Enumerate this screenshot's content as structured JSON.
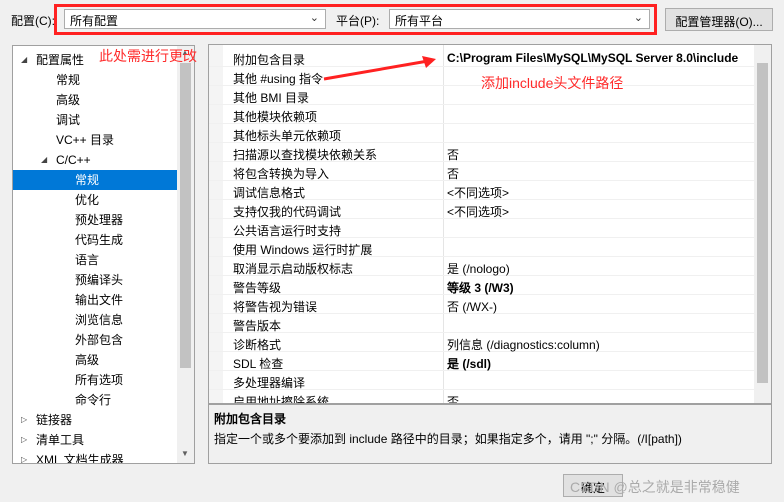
{
  "top": {
    "config_label": "配置(C):",
    "config_value": "所有配置",
    "platform_label": "平台(P):",
    "platform_value": "所有平台",
    "config_manager_button": "配置管理器(O)..."
  },
  "annotations": {
    "change_here": "此处需进行更改",
    "include_note": "添加include头文件路径",
    "accent": "#ff2121"
  },
  "tree": {
    "items": [
      {
        "label": "配置属性",
        "twisty": "◢"
      },
      {
        "label": "常规"
      },
      {
        "label": "高级"
      },
      {
        "label": "调试"
      },
      {
        "label": "VC++ 目录"
      },
      {
        "label": "C/C++",
        "twisty": "◢"
      },
      {
        "label": "常规"
      },
      {
        "label": "优化"
      },
      {
        "label": "预处理器"
      },
      {
        "label": "代码生成"
      },
      {
        "label": "语言"
      },
      {
        "label": "预编译头"
      },
      {
        "label": "输出文件"
      },
      {
        "label": "浏览信息"
      },
      {
        "label": "外部包含"
      },
      {
        "label": "高级"
      },
      {
        "label": "所有选项"
      },
      {
        "label": "命令行"
      },
      {
        "label": "链接器",
        "twisty": "▷"
      },
      {
        "label": "清单工具",
        "twisty": "▷"
      },
      {
        "label": "XML 文档生成器",
        "twisty": "▷"
      }
    ],
    "selected_index": 6
  },
  "properties": [
    {
      "name": "附加包含目录",
      "value": "C:\\Program Files\\MySQL\\MySQL Server 8.0\\include",
      "bold": true
    },
    {
      "name": "其他 #using 指令",
      "value": ""
    },
    {
      "name": "其他 BMI 目录",
      "value": ""
    },
    {
      "name": "其他模块依赖项",
      "value": ""
    },
    {
      "name": "其他标头单元依赖项",
      "value": ""
    },
    {
      "name": "扫描源以查找模块依赖关系",
      "value": "否"
    },
    {
      "name": "将包含转换为导入",
      "value": "否"
    },
    {
      "name": "调试信息格式",
      "value": "<不同选项>"
    },
    {
      "name": "支持仅我的代码调试",
      "value": "<不同选项>"
    },
    {
      "name": "公共语言运行时支持",
      "value": ""
    },
    {
      "name": "使用 Windows 运行时扩展",
      "value": ""
    },
    {
      "name": "取消显示启动版权标志",
      "value": "是 (/nologo)"
    },
    {
      "name": "警告等级",
      "value": "等级 3 (/W3)",
      "bold": true
    },
    {
      "name": "将警告视为错误",
      "value": "否 (/WX-)"
    },
    {
      "name": "警告版本",
      "value": ""
    },
    {
      "name": "诊断格式",
      "value": "列信息 (/diagnostics:column)"
    },
    {
      "name": "SDL 检查",
      "value": "是 (/sdl)",
      "bold": true
    },
    {
      "name": "多处理器编译",
      "value": ""
    },
    {
      "name": "启用地址擦除系统",
      "value": "否"
    }
  ],
  "description": {
    "title": "附加包含目录",
    "text": "指定一个或多个要添加到 include 路径中的目录；如果指定多个，请用 \";\" 分隔。(/I[path])"
  },
  "footer": {
    "ok_button": "确定",
    "watermark": "CSDN @总之就是非常稳健"
  }
}
